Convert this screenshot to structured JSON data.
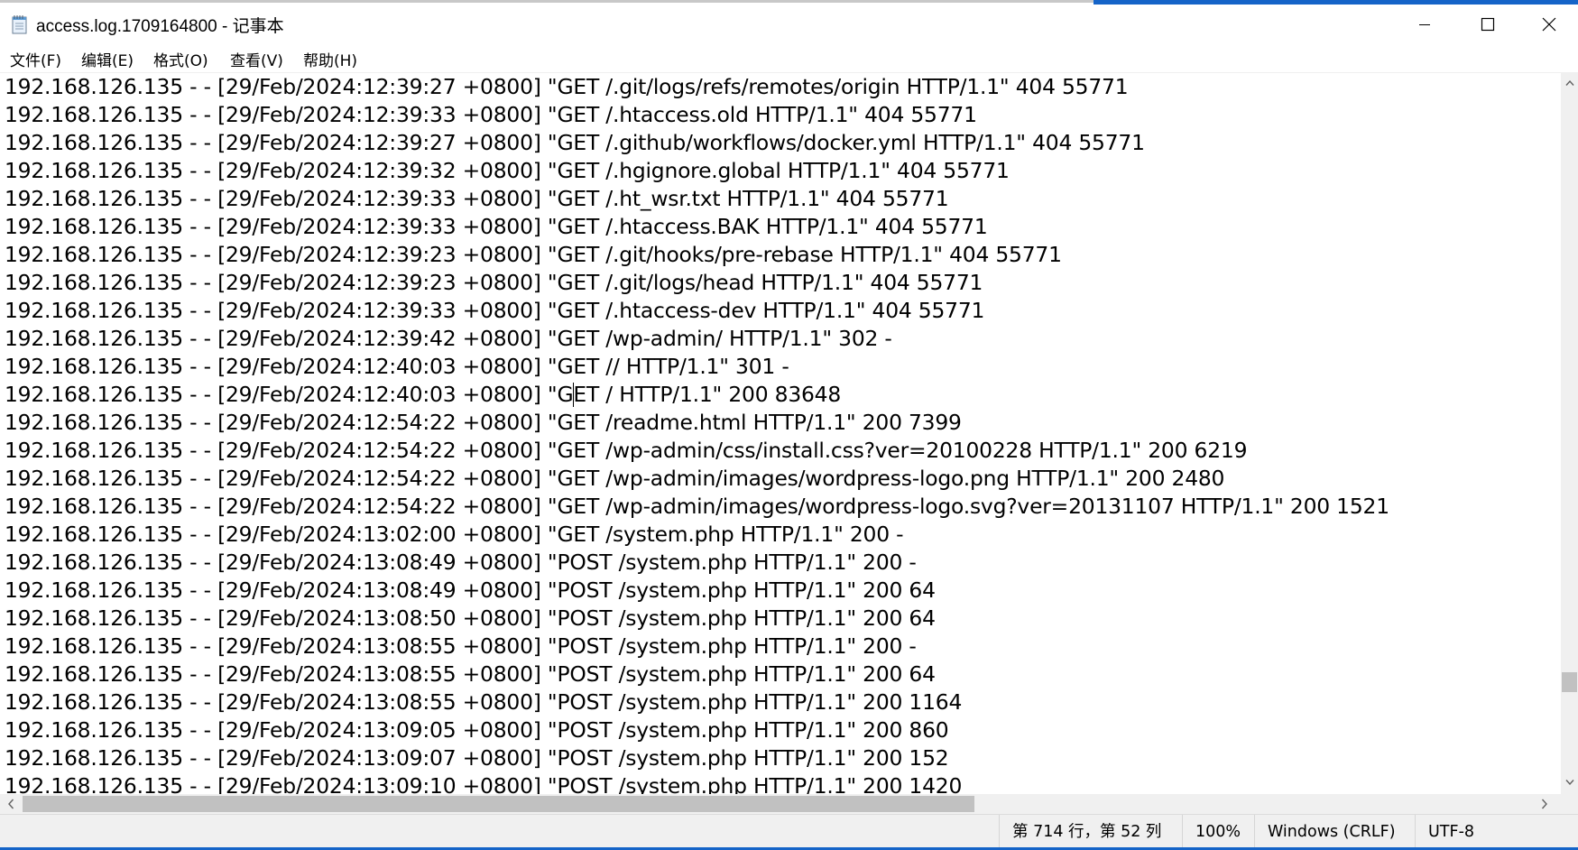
{
  "window": {
    "title": "access.log.1709164800 - 记事本",
    "accent_color": "#1564c8"
  },
  "menu": [
    {
      "label": "文件(F)"
    },
    {
      "label": "编辑(E)"
    },
    {
      "label": "格式(O)"
    },
    {
      "label": "查看(V)"
    },
    {
      "label": "帮助(H)"
    }
  ],
  "editor": {
    "lines": [
      "192.168.126.135 - - [29/Feb/2024:12:39:27 +0800] \"GET /.git/logs/refs/remotes/origin HTTP/1.1\" 404 55771",
      "192.168.126.135 - - [29/Feb/2024:12:39:33 +0800] \"GET /.htaccess.old HTTP/1.1\" 404 55771",
      "192.168.126.135 - - [29/Feb/2024:12:39:27 +0800] \"GET /.github/workflows/docker.yml HTTP/1.1\" 404 55771",
      "192.168.126.135 - - [29/Feb/2024:12:39:32 +0800] \"GET /.hgignore.global HTTP/1.1\" 404 55771",
      "192.168.126.135 - - [29/Feb/2024:12:39:33 +0800] \"GET /.ht_wsr.txt HTTP/1.1\" 404 55771",
      "192.168.126.135 - - [29/Feb/2024:12:39:33 +0800] \"GET /.htaccess.BAK HTTP/1.1\" 404 55771",
      "192.168.126.135 - - [29/Feb/2024:12:39:23 +0800] \"GET /.git/hooks/pre-rebase HTTP/1.1\" 404 55771",
      "192.168.126.135 - - [29/Feb/2024:12:39:23 +0800] \"GET /.git/logs/head HTTP/1.1\" 404 55771",
      "192.168.126.135 - - [29/Feb/2024:12:39:33 +0800] \"GET /.htaccess-dev HTTP/1.1\" 404 55771",
      "192.168.126.135 - - [29/Feb/2024:12:39:42 +0800] \"GET /wp-admin/ HTTP/1.1\" 302 -",
      "192.168.126.135 - - [29/Feb/2024:12:40:03 +0800] \"GET // HTTP/1.1\" 301 -",
      "192.168.126.135 - - [29/Feb/2024:12:40:03 +0800] \"GET / HTTP/1.1\" 200 83648",
      "192.168.126.135 - - [29/Feb/2024:12:54:22 +0800] \"GET /readme.html HTTP/1.1\" 200 7399",
      "192.168.126.135 - - [29/Feb/2024:12:54:22 +0800] \"GET /wp-admin/css/install.css?ver=20100228 HTTP/1.1\" 200 6219",
      "192.168.126.135 - - [29/Feb/2024:12:54:22 +0800] \"GET /wp-admin/images/wordpress-logo.png HTTP/1.1\" 200 2480",
      "192.168.126.135 - - [29/Feb/2024:12:54:22 +0800] \"GET /wp-admin/images/wordpress-logo.svg?ver=20131107 HTTP/1.1\" 200 1521",
      "192.168.126.135 - - [29/Feb/2024:13:02:00 +0800] \"GET /system.php HTTP/1.1\" 200 -",
      "192.168.126.135 - - [29/Feb/2024:13:08:49 +0800] \"POST /system.php HTTP/1.1\" 200 -",
      "192.168.126.135 - - [29/Feb/2024:13:08:49 +0800] \"POST /system.php HTTP/1.1\" 200 64",
      "192.168.126.135 - - [29/Feb/2024:13:08:50 +0800] \"POST /system.php HTTP/1.1\" 200 64",
      "192.168.126.135 - - [29/Feb/2024:13:08:55 +0800] \"POST /system.php HTTP/1.1\" 200 -",
      "192.168.126.135 - - [29/Feb/2024:13:08:55 +0800] \"POST /system.php HTTP/1.1\" 200 64",
      "192.168.126.135 - - [29/Feb/2024:13:08:55 +0800] \"POST /system.php HTTP/1.1\" 200 1164",
      "192.168.126.135 - - [29/Feb/2024:13:09:05 +0800] \"POST /system.php HTTP/1.1\" 200 860",
      "192.168.126.135 - - [29/Feb/2024:13:09:07 +0800] \"POST /system.php HTTP/1.1\" 200 152",
      "192.168.126.135 - - [29/Feb/2024:13:09:10 +0800] \"POST /system.php HTTP/1.1\" 200 1420"
    ],
    "caret_line_number": 12,
    "caret_column": 52
  },
  "scrollbars": {
    "vertical_position_fraction": 0.88,
    "horizontal_visible_fraction": 0.63
  },
  "status": {
    "position": "第 714 行，第 52 列",
    "zoom": "100%",
    "line_ending": "Windows (CRLF)",
    "encoding": "UTF-8"
  }
}
